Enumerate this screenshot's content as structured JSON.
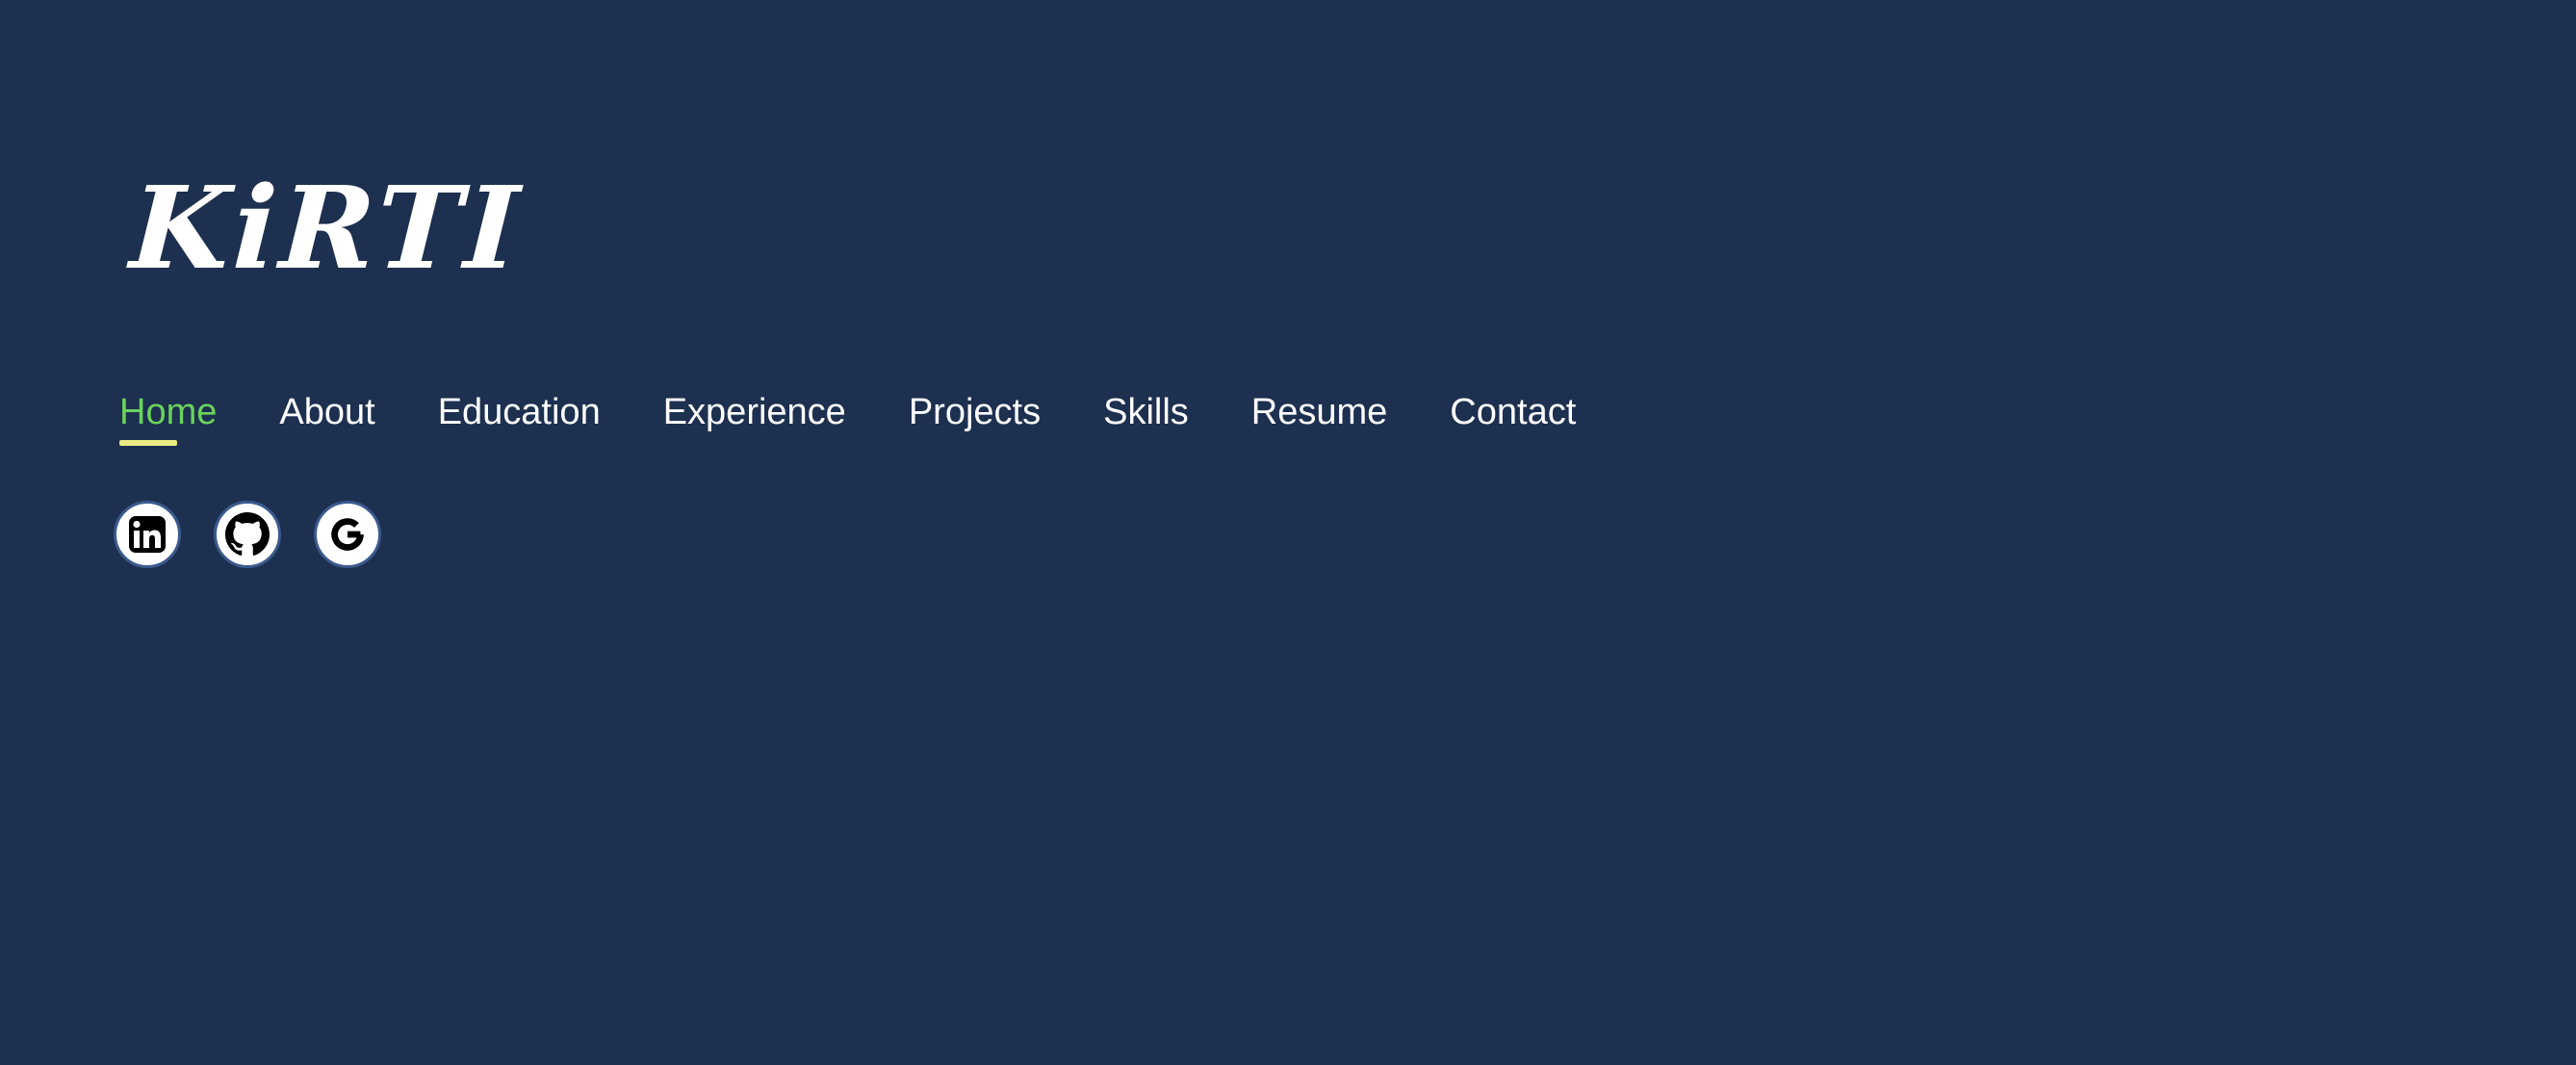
{
  "brand": {
    "name": "KiRTI"
  },
  "nav": {
    "items": [
      {
        "label": "Home",
        "active": true
      },
      {
        "label": "About",
        "active": false
      },
      {
        "label": "Education",
        "active": false
      },
      {
        "label": "Experience",
        "active": false
      },
      {
        "label": "Projects",
        "active": false
      },
      {
        "label": "Skills",
        "active": false
      },
      {
        "label": "Resume",
        "active": false
      },
      {
        "label": "Contact",
        "active": false
      }
    ]
  },
  "socials": [
    {
      "icon": "linkedin-icon"
    },
    {
      "icon": "github-icon"
    },
    {
      "icon": "google-icon"
    }
  ],
  "colors": {
    "background": "#1d3050",
    "text": "#ffffff",
    "active": "#6bd35c",
    "underline": "#ecec84"
  }
}
